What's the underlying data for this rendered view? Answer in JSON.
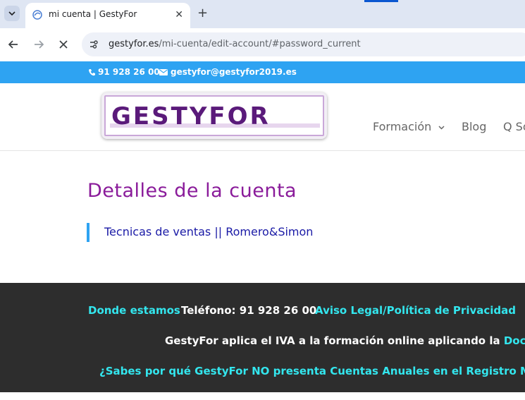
{
  "browser": {
    "tab_title": "mi cuenta | GestyFor",
    "close_glyph": "✕",
    "new_tab_glyph": "+",
    "url_host": "gestyfor.es",
    "url_path": "/mi-cuenta/edit-account/#password_current"
  },
  "topbar": {
    "phone": "91 928 26 00",
    "email": "gestyfor@gestyfor2019.es"
  },
  "header": {
    "logo_text": "GESTYFOR",
    "menu": [
      {
        "label": "Formación"
      },
      {
        "label": "Blog"
      },
      {
        "label": "Q So"
      }
    ]
  },
  "content": {
    "title": "Detalles de la cuenta",
    "quote": "Tecnicas de ventas || Romero&Simon"
  },
  "footer": {
    "link_location": "Donde estamos",
    "phone_text": "Teléfono: 91 928 26 00",
    "link_legal": "Aviso Legal/Política de Privacidad",
    "iva_text": "GestyFor aplica el IVA a la formación online aplicando la",
    "iva_link": "Doctrina",
    "accounts_link": "¿Sabes por qué GestyFor NO presenta Cuentas Anuales en el Registro Mercantil"
  },
  "colors": {
    "topbar": "#2ea3f2",
    "title": "#8a1b9a",
    "footer_bg": "#2d2d2d",
    "footer_link": "#33e6ee"
  }
}
